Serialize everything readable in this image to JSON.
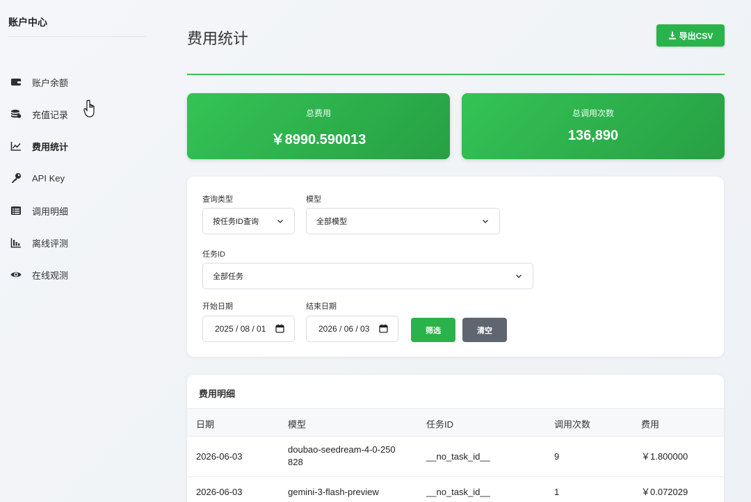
{
  "sidebar": {
    "title": "账户中心",
    "items": [
      {
        "label": "账户余额",
        "icon": "wallet-icon"
      },
      {
        "label": "充值记录",
        "icon": "coins-icon"
      },
      {
        "label": "费用统计",
        "icon": "chart-line-icon",
        "active": true
      },
      {
        "label": "API Key",
        "icon": "key-icon"
      },
      {
        "label": "调用明细",
        "icon": "list-icon"
      },
      {
        "label": "离线评测",
        "icon": "bar-chart-icon"
      },
      {
        "label": "在线观测",
        "icon": "eye-icon"
      }
    ]
  },
  "header": {
    "title": "费用统计",
    "export_label": "导出CSV"
  },
  "stats": {
    "total_cost_label": "总费用",
    "total_cost_value": "￥8990.590013",
    "total_calls_label": "总调用次数",
    "total_calls_value": "136,890"
  },
  "filters": {
    "query_type_label": "查询类型",
    "query_type_value": "按任务ID查询",
    "model_label": "模型",
    "model_value": "全部模型",
    "task_id_label": "任务ID",
    "task_id_value": "全部任务",
    "start_date_label": "开始日期",
    "start_date_value": "2025 / 08 / 01",
    "end_date_label": "结束日期",
    "end_date_value": "2026 / 06 / 03",
    "filter_button": "筛选",
    "clear_button": "清空"
  },
  "table": {
    "title": "费用明细",
    "headers": [
      "日期",
      "模型",
      "任务ID",
      "调用次数",
      "费用"
    ],
    "rows": [
      {
        "date": "2026-06-03",
        "model_line1": "doubao-seedream-4-0-250",
        "model_line2": "828",
        "task_id": "__no_task_id__",
        "calls": "9",
        "cost": "￥1.800000"
      },
      {
        "date": "2026-06-03",
        "model_line1": "gemini-3-flash-preview",
        "model_line2": "",
        "task_id": "__no_task_id__",
        "calls": "1",
        "cost": "￥0.072029"
      }
    ]
  },
  "colors": {
    "accent": "#2bb34b",
    "clear_button": "#5f6670"
  }
}
